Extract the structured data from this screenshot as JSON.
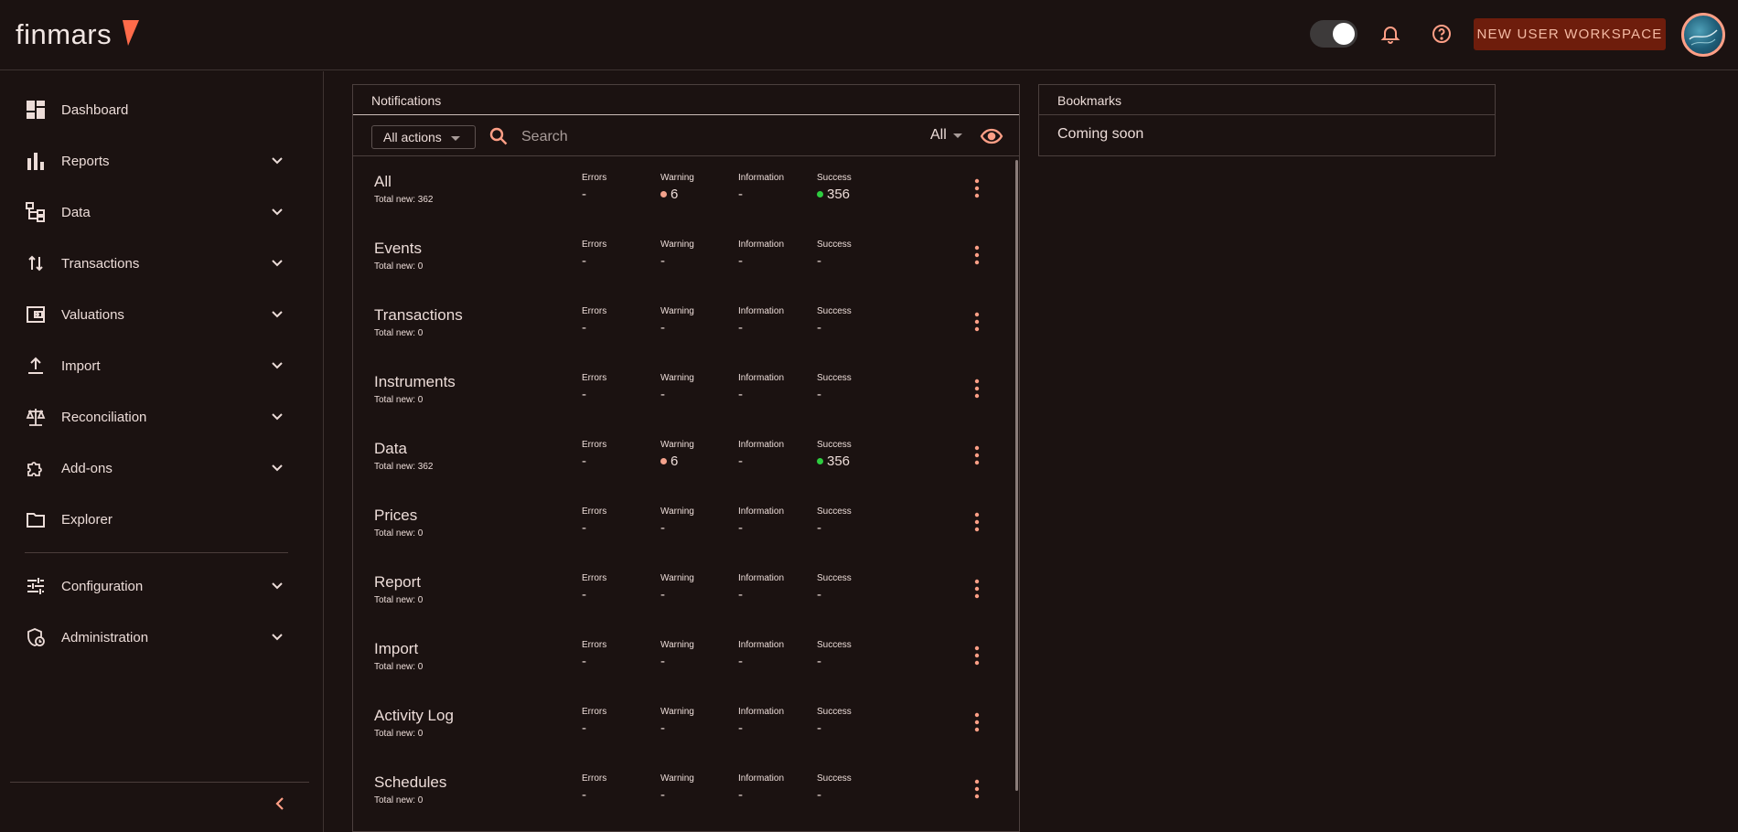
{
  "header": {
    "logo_text": "finmars",
    "workspace_button": "NEW USER WORKSPACE",
    "accent_color": "#ff6b4a"
  },
  "sidebar": {
    "items": [
      {
        "label": "Dashboard",
        "icon": "dashboard-icon",
        "expandable": false
      },
      {
        "label": "Reports",
        "icon": "bar-chart-icon",
        "expandable": true
      },
      {
        "label": "Data",
        "icon": "tree-icon",
        "expandable": true
      },
      {
        "label": "Transactions",
        "icon": "swap-vertical-icon",
        "expandable": true
      },
      {
        "label": "Valuations",
        "icon": "wallet-icon",
        "expandable": true
      },
      {
        "label": "Import",
        "icon": "upload-icon",
        "expandable": true
      },
      {
        "label": "Reconciliation",
        "icon": "scale-icon",
        "expandable": true
      },
      {
        "label": "Add-ons",
        "icon": "puzzle-icon",
        "expandable": true
      },
      {
        "label": "Explorer",
        "icon": "folder-icon",
        "expandable": false
      },
      {
        "label": "Configuration",
        "icon": "tune-icon",
        "expandable": true
      },
      {
        "label": "Administration",
        "icon": "admin-shield-icon",
        "expandable": true
      }
    ]
  },
  "notifications": {
    "title": "Notifications",
    "actions_select": "All actions",
    "search_placeholder": "Search",
    "filter": "All",
    "stat_labels": {
      "errors": "Errors",
      "warning": "Warning",
      "information": "Information",
      "success": "Success"
    },
    "rows": [
      {
        "title": "All",
        "total": "Total new: 362",
        "errors": "-",
        "warning": "6",
        "information": "-",
        "success": "356"
      },
      {
        "title": "Events",
        "total": "Total new: 0",
        "errors": "-",
        "warning": "-",
        "information": "-",
        "success": "-"
      },
      {
        "title": "Transactions",
        "total": "Total new: 0",
        "errors": "-",
        "warning": "-",
        "information": "-",
        "success": "-"
      },
      {
        "title": "Instruments",
        "total": "Total new: 0",
        "errors": "-",
        "warning": "-",
        "information": "-",
        "success": "-"
      },
      {
        "title": "Data",
        "total": "Total new: 362",
        "errors": "-",
        "warning": "6",
        "information": "-",
        "success": "356"
      },
      {
        "title": "Prices",
        "total": "Total new: 0",
        "errors": "-",
        "warning": "-",
        "information": "-",
        "success": "-"
      },
      {
        "title": "Report",
        "total": "Total new: 0",
        "errors": "-",
        "warning": "-",
        "information": "-",
        "success": "-"
      },
      {
        "title": "Import",
        "total": "Total new: 0",
        "errors": "-",
        "warning": "-",
        "information": "-",
        "success": "-"
      },
      {
        "title": "Activity Log",
        "total": "Total new: 0",
        "errors": "-",
        "warning": "-",
        "information": "-",
        "success": "-"
      },
      {
        "title": "Schedules",
        "total": "Total new: 0",
        "errors": "-",
        "warning": "-",
        "information": "-",
        "success": "-"
      }
    ]
  },
  "bookmarks": {
    "title": "Bookmarks",
    "body": "Coming soon"
  }
}
